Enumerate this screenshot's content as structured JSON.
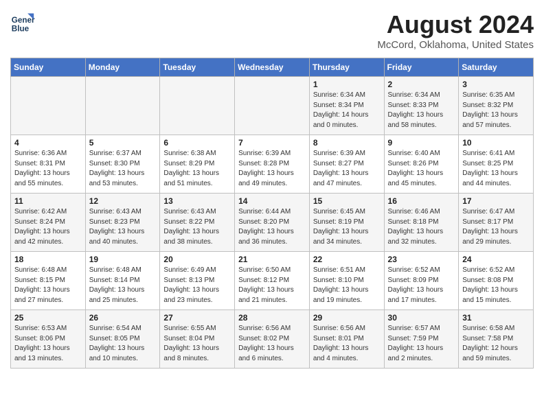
{
  "header": {
    "logo_line1": "General",
    "logo_line2": "Blue",
    "month_year": "August 2024",
    "location": "McCord, Oklahoma, United States"
  },
  "weekdays": [
    "Sunday",
    "Monday",
    "Tuesday",
    "Wednesday",
    "Thursday",
    "Friday",
    "Saturday"
  ],
  "weeks": [
    [
      {
        "day": "",
        "info": ""
      },
      {
        "day": "",
        "info": ""
      },
      {
        "day": "",
        "info": ""
      },
      {
        "day": "",
        "info": ""
      },
      {
        "day": "1",
        "info": "Sunrise: 6:34 AM\nSunset: 8:34 PM\nDaylight: 14 hours\nand 0 minutes."
      },
      {
        "day": "2",
        "info": "Sunrise: 6:34 AM\nSunset: 8:33 PM\nDaylight: 13 hours\nand 58 minutes."
      },
      {
        "day": "3",
        "info": "Sunrise: 6:35 AM\nSunset: 8:32 PM\nDaylight: 13 hours\nand 57 minutes."
      }
    ],
    [
      {
        "day": "4",
        "info": "Sunrise: 6:36 AM\nSunset: 8:31 PM\nDaylight: 13 hours\nand 55 minutes."
      },
      {
        "day": "5",
        "info": "Sunrise: 6:37 AM\nSunset: 8:30 PM\nDaylight: 13 hours\nand 53 minutes."
      },
      {
        "day": "6",
        "info": "Sunrise: 6:38 AM\nSunset: 8:29 PM\nDaylight: 13 hours\nand 51 minutes."
      },
      {
        "day": "7",
        "info": "Sunrise: 6:39 AM\nSunset: 8:28 PM\nDaylight: 13 hours\nand 49 minutes."
      },
      {
        "day": "8",
        "info": "Sunrise: 6:39 AM\nSunset: 8:27 PM\nDaylight: 13 hours\nand 47 minutes."
      },
      {
        "day": "9",
        "info": "Sunrise: 6:40 AM\nSunset: 8:26 PM\nDaylight: 13 hours\nand 45 minutes."
      },
      {
        "day": "10",
        "info": "Sunrise: 6:41 AM\nSunset: 8:25 PM\nDaylight: 13 hours\nand 44 minutes."
      }
    ],
    [
      {
        "day": "11",
        "info": "Sunrise: 6:42 AM\nSunset: 8:24 PM\nDaylight: 13 hours\nand 42 minutes."
      },
      {
        "day": "12",
        "info": "Sunrise: 6:43 AM\nSunset: 8:23 PM\nDaylight: 13 hours\nand 40 minutes."
      },
      {
        "day": "13",
        "info": "Sunrise: 6:43 AM\nSunset: 8:22 PM\nDaylight: 13 hours\nand 38 minutes."
      },
      {
        "day": "14",
        "info": "Sunrise: 6:44 AM\nSunset: 8:20 PM\nDaylight: 13 hours\nand 36 minutes."
      },
      {
        "day": "15",
        "info": "Sunrise: 6:45 AM\nSunset: 8:19 PM\nDaylight: 13 hours\nand 34 minutes."
      },
      {
        "day": "16",
        "info": "Sunrise: 6:46 AM\nSunset: 8:18 PM\nDaylight: 13 hours\nand 32 minutes."
      },
      {
        "day": "17",
        "info": "Sunrise: 6:47 AM\nSunset: 8:17 PM\nDaylight: 13 hours\nand 29 minutes."
      }
    ],
    [
      {
        "day": "18",
        "info": "Sunrise: 6:48 AM\nSunset: 8:15 PM\nDaylight: 13 hours\nand 27 minutes."
      },
      {
        "day": "19",
        "info": "Sunrise: 6:48 AM\nSunset: 8:14 PM\nDaylight: 13 hours\nand 25 minutes."
      },
      {
        "day": "20",
        "info": "Sunrise: 6:49 AM\nSunset: 8:13 PM\nDaylight: 13 hours\nand 23 minutes."
      },
      {
        "day": "21",
        "info": "Sunrise: 6:50 AM\nSunset: 8:12 PM\nDaylight: 13 hours\nand 21 minutes."
      },
      {
        "day": "22",
        "info": "Sunrise: 6:51 AM\nSunset: 8:10 PM\nDaylight: 13 hours\nand 19 minutes."
      },
      {
        "day": "23",
        "info": "Sunrise: 6:52 AM\nSunset: 8:09 PM\nDaylight: 13 hours\nand 17 minutes."
      },
      {
        "day": "24",
        "info": "Sunrise: 6:52 AM\nSunset: 8:08 PM\nDaylight: 13 hours\nand 15 minutes."
      }
    ],
    [
      {
        "day": "25",
        "info": "Sunrise: 6:53 AM\nSunset: 8:06 PM\nDaylight: 13 hours\nand 13 minutes."
      },
      {
        "day": "26",
        "info": "Sunrise: 6:54 AM\nSunset: 8:05 PM\nDaylight: 13 hours\nand 10 minutes."
      },
      {
        "day": "27",
        "info": "Sunrise: 6:55 AM\nSunset: 8:04 PM\nDaylight: 13 hours\nand 8 minutes."
      },
      {
        "day": "28",
        "info": "Sunrise: 6:56 AM\nSunset: 8:02 PM\nDaylight: 13 hours\nand 6 minutes."
      },
      {
        "day": "29",
        "info": "Sunrise: 6:56 AM\nSunset: 8:01 PM\nDaylight: 13 hours\nand 4 minutes."
      },
      {
        "day": "30",
        "info": "Sunrise: 6:57 AM\nSunset: 7:59 PM\nDaylight: 13 hours\nand 2 minutes."
      },
      {
        "day": "31",
        "info": "Sunrise: 6:58 AM\nSunset: 7:58 PM\nDaylight: 12 hours\nand 59 minutes."
      }
    ]
  ]
}
